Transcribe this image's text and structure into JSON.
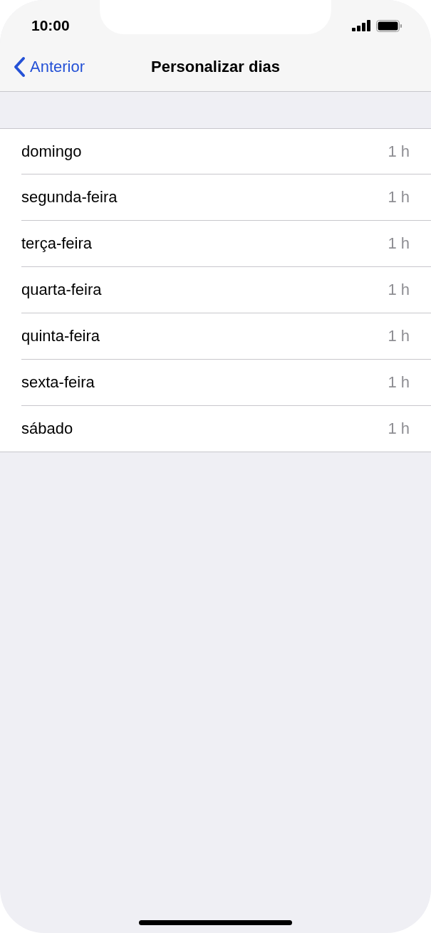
{
  "status_bar": {
    "time": "10:00"
  },
  "nav_bar": {
    "back": "Anterior",
    "title": "Personalizar dias"
  },
  "days": [
    {
      "name": "domingo",
      "value": "1 h"
    },
    {
      "name": "segunda-feira",
      "value": "1 h"
    },
    {
      "name": "terça-feira",
      "value": "1 h"
    },
    {
      "name": "quarta-feira",
      "value": "1 h"
    },
    {
      "name": "quinta-feira",
      "value": "1 h"
    },
    {
      "name": "sexta-feira",
      "value": "1 h"
    },
    {
      "name": "sábado",
      "value": "1 h"
    }
  ]
}
